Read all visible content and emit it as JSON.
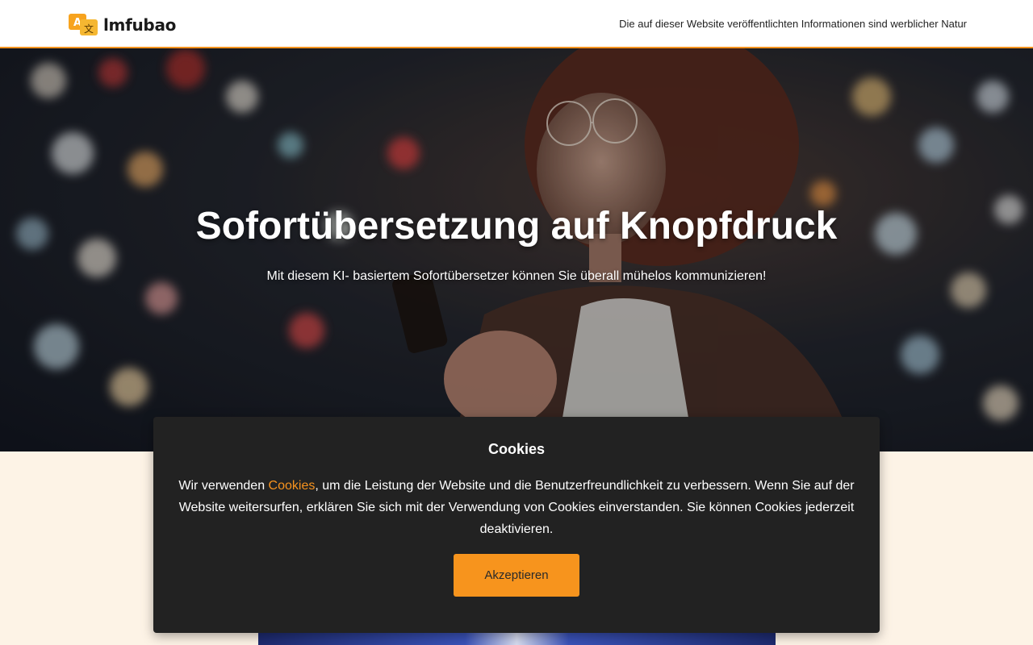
{
  "header": {
    "brand": "lmfubao",
    "logo_icon": "translate-icon",
    "disclaimer": "Die auf dieser Website veröffentlichten Informationen sind werblicher Natur"
  },
  "hero": {
    "title": "Sofortübersetzung auf Knopfdruck",
    "subtitle": "Mit diesem KI- basiertem Sofortübersetzer können Sie überall mühelos kommunizieren!"
  },
  "cookie_banner": {
    "title": "Cookies",
    "text_before": "Wir verwenden ",
    "link_text": "Cookies",
    "text_after": ", um die Leistung der Website und die Benutzerfreundlichkeit zu verbessern. Wenn Sie auf der Website weitersurfen, erklären Sie sich mit der Verwendung von Cookies einverstanden. Sie können Cookies jederzeit deaktivieren.",
    "accept_label": "Akzeptieren"
  },
  "colors": {
    "accent": "#f7931e",
    "banner_bg": "#222222",
    "page_bg": "#fdf3e6"
  }
}
